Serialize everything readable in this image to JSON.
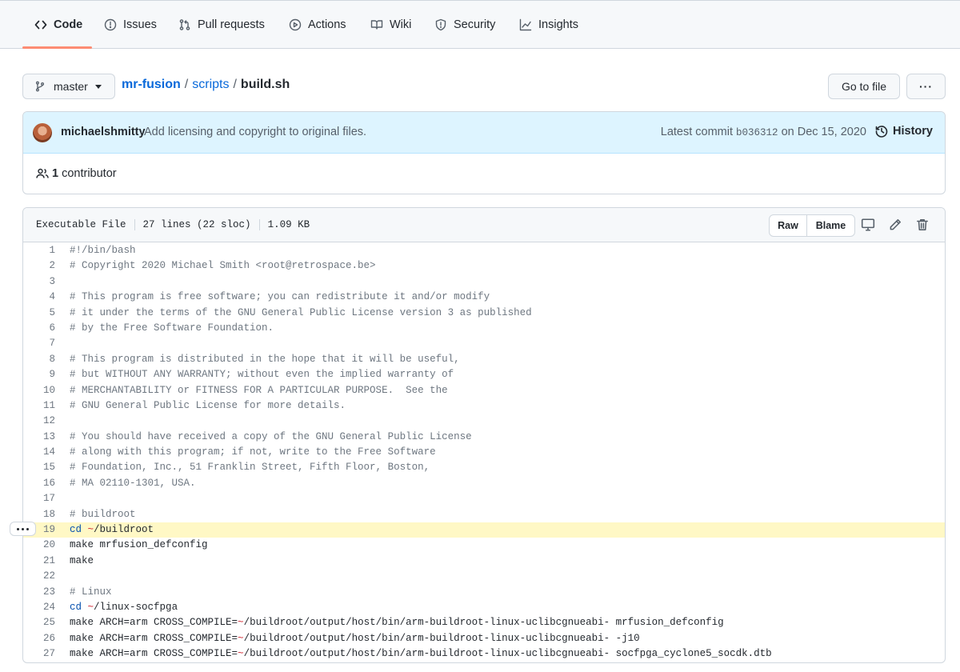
{
  "nav": {
    "tabs": [
      {
        "label": "Code",
        "icon": "code-icon",
        "selected": true
      },
      {
        "label": "Issues",
        "icon": "issue-opened-icon"
      },
      {
        "label": "Pull requests",
        "icon": "git-pull-request-icon"
      },
      {
        "label": "Actions",
        "icon": "play-icon"
      },
      {
        "label": "Wiki",
        "icon": "book-icon"
      },
      {
        "label": "Security",
        "icon": "shield-icon"
      },
      {
        "label": "Insights",
        "icon": "graph-icon"
      }
    ],
    "accent_color": "#fd8c73"
  },
  "breadcrumb": {
    "branch": "master",
    "repo": "mr-fusion",
    "sep1": "/",
    "folder": "scripts",
    "sep2": "/",
    "file": "build.sh"
  },
  "actions": {
    "go_to_file": "Go to file",
    "more": "···"
  },
  "commit": {
    "author": "michaelshmitty",
    "message": "Add licensing and copyright to original files.",
    "latest_label": "Latest commit",
    "sha": "b036312",
    "date": "on Dec 15, 2020",
    "history": "History",
    "contributors_count": "1",
    "contributors_label": "contributor"
  },
  "file": {
    "mode": "Executable File",
    "lines_info": "27 lines (22 sloc)",
    "size": "1.09 KB",
    "raw": "Raw",
    "blame": "Blame",
    "highlighted_line": 19,
    "lines": [
      "#!/bin/bash",
      "# Copyright 2020 Michael Smith <root@retrospace.be>",
      "",
      "# This program is free software; you can redistribute it and/or modify",
      "# it under the terms of the GNU General Public License version 3 as published",
      "# by the Free Software Foundation.",
      "",
      "# This program is distributed in the hope that it will be useful,",
      "# but WITHOUT ANY WARRANTY; without even the implied warranty of",
      "# MERCHANTABILITY or FITNESS FOR A PARTICULAR PURPOSE.  See the",
      "# GNU General Public License for more details.",
      "",
      "# You should have received a copy of the GNU General Public License",
      "# along with this program; if not, write to the Free Software",
      "# Foundation, Inc., 51 Franklin Street, Fifth Floor, Boston,",
      "# MA 02110-1301, USA.",
      "",
      "# buildroot",
      "cd ~/buildroot",
      "make mrfusion_defconfig",
      "make",
      "",
      "# Linux",
      "cd ~/linux-socfpga",
      "make ARCH=arm CROSS_COMPILE=~/buildroot/output/host/bin/arm-buildroot-linux-uclibcgnueabi- mrfusion_defconfig",
      "make ARCH=arm CROSS_COMPILE=~/buildroot/output/host/bin/arm-buildroot-linux-uclibcgnueabi- -j10",
      "make ARCH=arm CROSS_COMPILE=~/buildroot/output/host/bin/arm-buildroot-linux-uclibcgnueabi- socfpga_cyclone5_socdk.dtb"
    ]
  }
}
